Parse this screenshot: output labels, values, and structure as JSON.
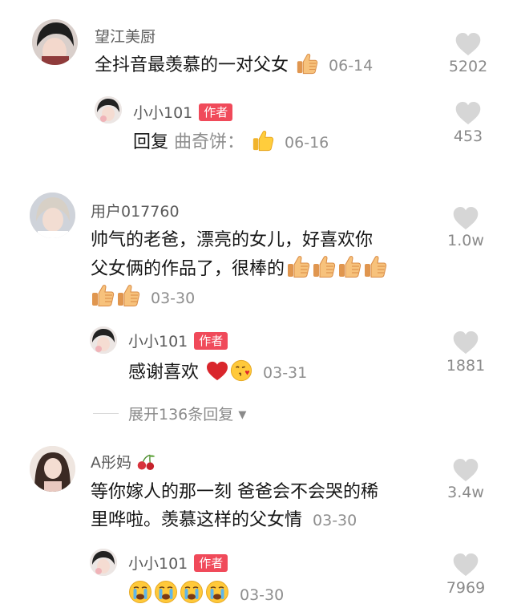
{
  "comments": [
    {
      "user": "望江美厨",
      "text": "全抖音最羡慕的一对父女",
      "date": "06-14",
      "likes": "5202",
      "reply": {
        "user": "小小101",
        "tag": "作者",
        "prefix": "回复",
        "reply_to": "曲奇饼：",
        "date": "06-16",
        "likes": "453"
      }
    },
    {
      "user": "用户017760",
      "text_line1": "帅气的老爸，漂亮的女儿，好喜欢你",
      "text_line2": "父女俩的作品了，很棒的",
      "date": "03-30",
      "likes": "1.0w",
      "reply": {
        "user": "小小101",
        "tag": "作者",
        "text": "感谢喜欢",
        "date": "03-31",
        "likes": "1881"
      },
      "expand_label": "展开136条回复"
    },
    {
      "user": "A彤妈",
      "text_line1": "等你嫁人的那一刻 爸爸会不会哭的稀",
      "text_line2": "里哗啦。羡慕这样的父女情",
      "date": "03-30",
      "likes": "3.4w",
      "reply": {
        "user": "小小101",
        "tag": "作者",
        "date": "03-30",
        "likes": "7969"
      }
    }
  ],
  "icons": {
    "like": "heart-outline-icon",
    "thumb": "thumbs-up-emoji",
    "heart": "red-heart-emoji",
    "kiss": "kissing-face-emoji",
    "cry": "crying-face-emoji",
    "cherry": "cherry-emoji",
    "chevron": "chevron-down-icon"
  },
  "colors": {
    "author_tag": "#f04a5a",
    "muted_text": "#8e8e8e",
    "like_icon": "#d6d6d6"
  }
}
